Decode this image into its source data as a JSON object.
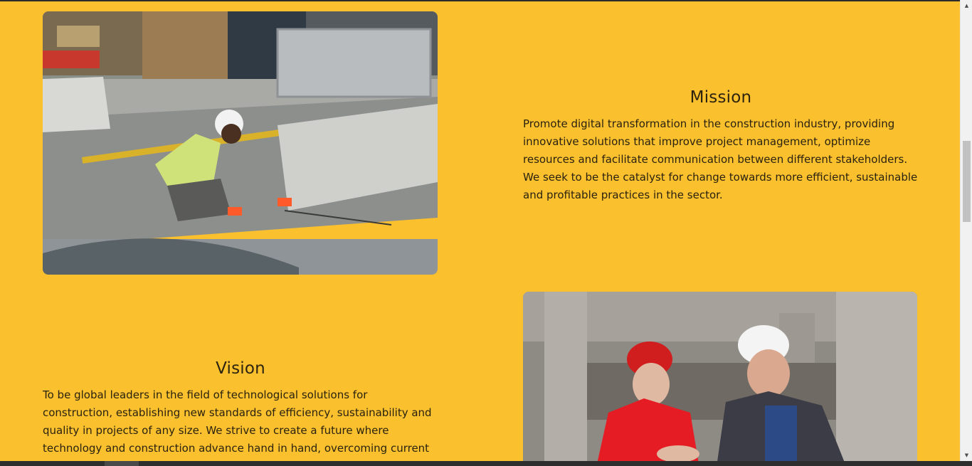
{
  "mission": {
    "title": "Mission",
    "text": "Promote digital transformation in the construction industry, providing innovative solutions that improve project management, optimize resources and facilitate communication between different stakeholders. We seek to be the catalyst for change towards more efficient, sustainable and profitable practices in the sector."
  },
  "vision": {
    "title": "Vision",
    "text": "To be global leaders in the field of technological solutions for construction, establishing new standards of efficiency, sustainability and quality in projects of any size. We strive to create a future where technology and construction advance hand in hand, overcoming current challenges and opening the way to"
  },
  "images": {
    "mission_photo": "construction-worker-street-photo",
    "vision_photo": "engineers-hardhats-photo"
  },
  "colors": {
    "background": "#fbc02d",
    "text": "#2a2210"
  }
}
